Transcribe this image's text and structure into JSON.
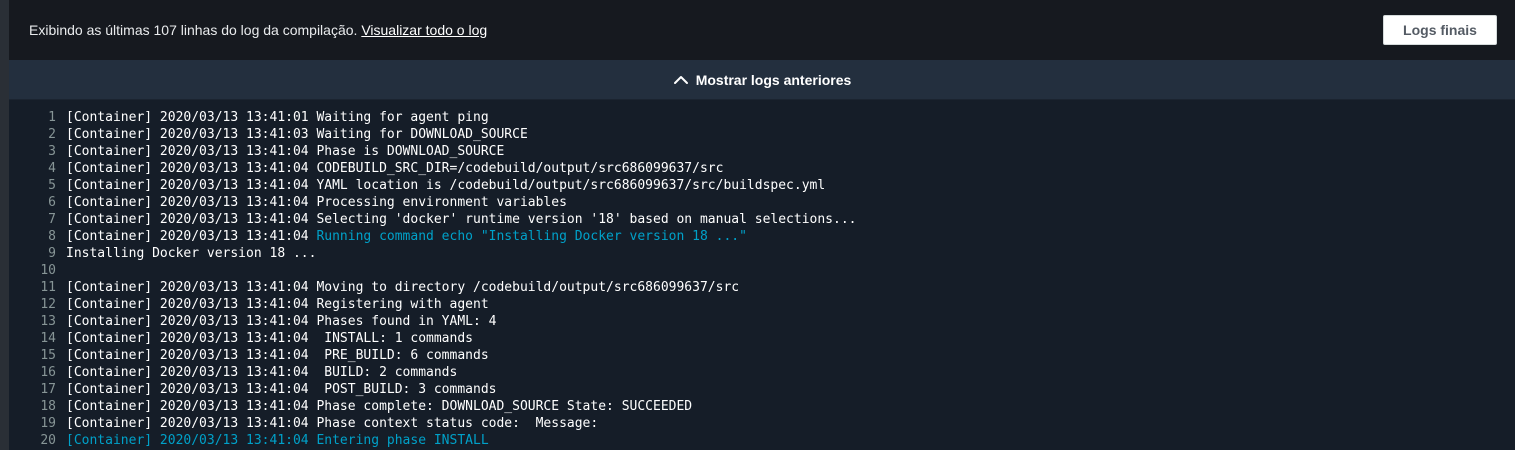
{
  "header": {
    "status_text": "Exibindo as últimas 107 linhas do log da compilação.",
    "view_all_link": "Visualizar todo o log",
    "final_logs_button": "Logs finais"
  },
  "show_earlier": {
    "label": "Mostrar logs anteriores",
    "icon": "chevron-up-icon"
  },
  "colors": {
    "highlight": "#00a1c9",
    "text": "#ffffff",
    "line_number": "#879596"
  },
  "log_lines": [
    {
      "n": "1",
      "text": "[Container] 2020/03/13 13:41:01 Waiting for agent ping",
      "hl": false
    },
    {
      "n": "2",
      "text": "[Container] 2020/03/13 13:41:03 Waiting for DOWNLOAD_SOURCE",
      "hl": false
    },
    {
      "n": "3",
      "text": "[Container] 2020/03/13 13:41:04 Phase is DOWNLOAD_SOURCE",
      "hl": false
    },
    {
      "n": "4",
      "text": "[Container] 2020/03/13 13:41:04 CODEBUILD_SRC_DIR=/codebuild/output/src686099637/src",
      "hl": false
    },
    {
      "n": "5",
      "text": "[Container] 2020/03/13 13:41:04 YAML location is /codebuild/output/src686099637/src/buildspec.yml",
      "hl": false
    },
    {
      "n": "6",
      "text": "[Container] 2020/03/13 13:41:04 Processing environment variables",
      "hl": false
    },
    {
      "n": "7",
      "text": "[Container] 2020/03/13 13:41:04 Selecting 'docker' runtime version '18' based on manual selections...",
      "hl": false
    },
    {
      "n": "8",
      "text": "[Container] 2020/03/13 13:41:04 ",
      "hl_text": "Running command echo \"Installing Docker version 18 ...\"",
      "hl": "partial"
    },
    {
      "n": "9",
      "text": "Installing Docker version 18 ...",
      "hl": false
    },
    {
      "n": "10",
      "text": "",
      "hl": false
    },
    {
      "n": "11",
      "text": "[Container] 2020/03/13 13:41:04 Moving to directory /codebuild/output/src686099637/src",
      "hl": false
    },
    {
      "n": "12",
      "text": "[Container] 2020/03/13 13:41:04 Registering with agent",
      "hl": false
    },
    {
      "n": "13",
      "text": "[Container] 2020/03/13 13:41:04 Phases found in YAML: 4",
      "hl": false
    },
    {
      "n": "14",
      "text": "[Container] 2020/03/13 13:41:04  INSTALL: 1 commands",
      "hl": false
    },
    {
      "n": "15",
      "text": "[Container] 2020/03/13 13:41:04  PRE_BUILD: 6 commands",
      "hl": false
    },
    {
      "n": "16",
      "text": "[Container] 2020/03/13 13:41:04  BUILD: 2 commands",
      "hl": false
    },
    {
      "n": "17",
      "text": "[Container] 2020/03/13 13:41:04  POST_BUILD: 3 commands",
      "hl": false
    },
    {
      "n": "18",
      "text": "[Container] 2020/03/13 13:41:04 Phase complete: DOWNLOAD_SOURCE State: SUCCEEDED",
      "hl": false
    },
    {
      "n": "19",
      "text": "[Container] 2020/03/13 13:41:04 Phase context status code:  Message:",
      "hl": false
    },
    {
      "n": "20",
      "text": "[Container] 2020/03/13 13:41:04 Entering phase INSTALL",
      "hl": true
    }
  ]
}
